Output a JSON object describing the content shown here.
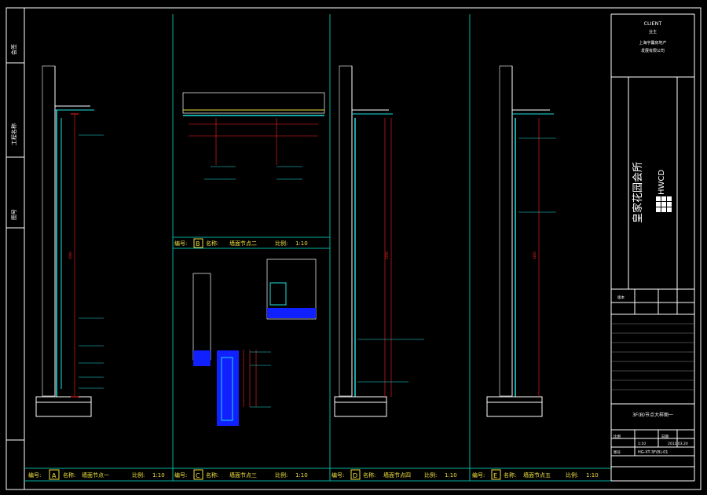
{
  "colors": {
    "background": "#000000",
    "frame": "#ffffff",
    "panel_divider": "#00b0a0",
    "dimension": "#ff2020",
    "leader": "#20e0e0",
    "wall": "#ffffff",
    "finish_fill": "#1020ff",
    "yellow": "#f0e040"
  },
  "title_block": {
    "client_label": "CLIENT",
    "client_sub": "业主",
    "client_line1": "上海宇馨房地产",
    "client_line2": "发展有限公司",
    "project_cn": "皇家花园会所",
    "firm_logo": "HWCD",
    "drawing_title": "3F(B)节点大样图一",
    "scale_value": "1:10",
    "date_value": "2012.03.20",
    "drawing_no": "HG-XT-3F(B)-01",
    "revision_label": "版本",
    "scale_label": "比例",
    "date_label": "日期",
    "number_label": "图号"
  },
  "panels": [
    {
      "letter": "A",
      "no_label": "编号:",
      "name_label": "名称:",
      "name": "墙面节点一",
      "scale_label": "比例:",
      "scale": "1:10"
    },
    {
      "letter": "B",
      "no_label": "编号:",
      "name_label": "名称:",
      "name": "墙面节点二",
      "scale_label": "比例:",
      "scale": "1:10"
    },
    {
      "letter": "C",
      "no_label": "编号:",
      "name_label": "名称:",
      "name": "墙面节点三",
      "scale_label": "比例:",
      "scale": "1:10"
    },
    {
      "letter": "D",
      "no_label": "编号:",
      "name_label": "名称:",
      "name": "墙面节点四",
      "scale_label": "比例:",
      "scale": "1:10"
    },
    {
      "letter": "E",
      "no_label": "编号:",
      "name_label": "名称:",
      "name": "墙面节点五",
      "scale_label": "比例:",
      "scale": "1:10"
    }
  ],
  "left_margin": {
    "label1": "会签",
    "label2": "工程名称",
    "label3": "图号"
  },
  "dimensions": {
    "A_total": "3900",
    "D_total": "3700",
    "E_total": "3450"
  }
}
